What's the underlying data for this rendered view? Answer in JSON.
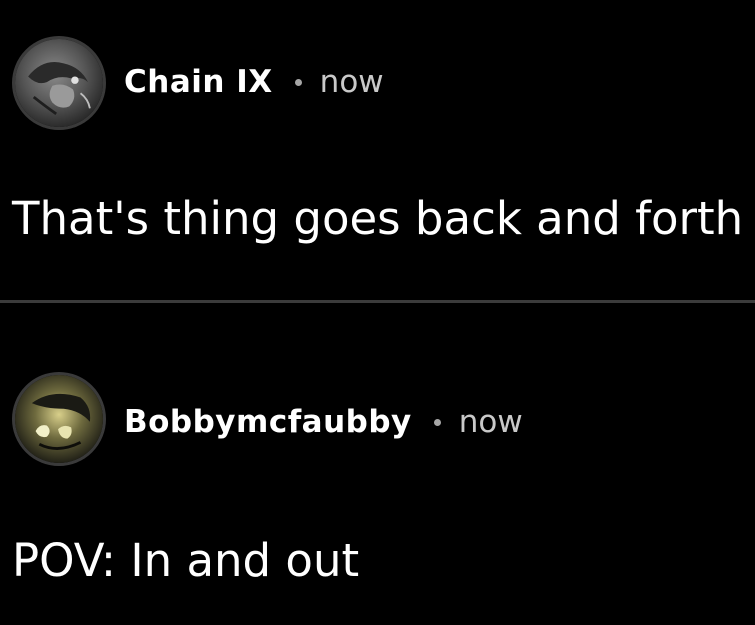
{
  "comments": [
    {
      "username": "Chain IX",
      "separator_icon": "dot-separator",
      "timestamp": "now",
      "text": "That's thing goes back and forth",
      "avatar_icon": "user-avatar"
    },
    {
      "username": "Bobbymcfaubby",
      "separator_icon": "dot-separator",
      "timestamp": "now",
      "text": "POV: In and out",
      "avatar_icon": "user-avatar"
    }
  ],
  "colors": {
    "background": "#000000",
    "text": "#ffffff",
    "meta": "#c9c9c9",
    "divider": "#3b3b3b"
  }
}
